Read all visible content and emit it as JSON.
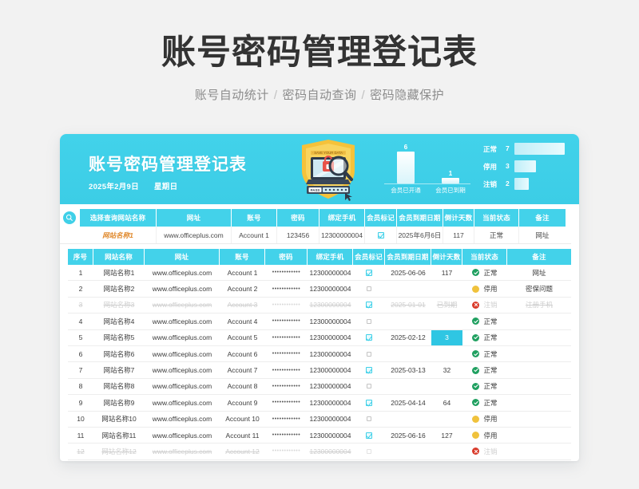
{
  "page": {
    "title": "账号密码管理登记表",
    "subtitle_parts": [
      "账号自动统计",
      "密码自动查询",
      "密码隐藏保护"
    ],
    "separator": "/",
    "background_color": "#f2f2f2",
    "accent_color": "#3fd0e8"
  },
  "banner": {
    "title": "账号密码管理登记表",
    "date": "2025年2月9日",
    "weekday": "星期日",
    "logo_name": "shield-lock-search-badge",
    "logo_text": "PASS"
  },
  "member_chart": {
    "type": "bar",
    "categories": [
      "会员已开通",
      "会员已到期"
    ],
    "values": [
      6,
      1
    ],
    "title": "",
    "xlabel": "",
    "ylabel": "",
    "ylim": [
      0,
      7
    ]
  },
  "status_chart": {
    "type": "bar",
    "orientation": "horizontal",
    "categories": [
      "正常",
      "停用",
      "注销"
    ],
    "values": [
      7,
      3,
      2
    ],
    "xlim": [
      0,
      7
    ]
  },
  "query": {
    "search_icon": "search-icon",
    "headers": [
      "选择查询网站名称",
      "网址",
      "账号",
      "密码",
      "绑定手机",
      "会员标记",
      "会员到期日期",
      "倒计天数",
      "当前状态",
      "备注"
    ],
    "row": {
      "site": "网站名称1",
      "url": "www.officeplus.com",
      "account": "Account 1",
      "password": "123456",
      "phone": "12300000004",
      "member": "checked",
      "expire": "2025年6月6日",
      "countdown": "117",
      "status": "正常",
      "note": "网址"
    }
  },
  "table": {
    "headers": [
      "序号",
      "网站名称",
      "网址",
      "账号",
      "密码",
      "绑定手机",
      "会员标记",
      "会员到期日期",
      "倒计天数",
      "当前状态",
      "备注"
    ],
    "password_mask": "••••••••••••",
    "rows": [
      {
        "no": "1",
        "site": "网站名称1",
        "url": "www.officeplus.com",
        "account": "Account 1",
        "phone": "12300000004",
        "member": "checked",
        "expire": "2025-06-06",
        "countdown": "117",
        "countdown_highlight": false,
        "status": "正常",
        "status_kind": "ok",
        "note": "网址",
        "dim": false
      },
      {
        "no": "2",
        "site": "网站名称2",
        "url": "www.officeplus.com",
        "account": "Account 2",
        "phone": "12300000004",
        "member": "unchecked",
        "expire": "",
        "countdown": "",
        "countdown_highlight": false,
        "status": "停用",
        "status_kind": "pause",
        "note": "密保问题",
        "dim": false
      },
      {
        "no": "3",
        "site": "网站名称3",
        "url": "www.officeplus.com",
        "account": "Account 3",
        "phone": "12300000004",
        "member": "checked",
        "expire": "2025-01-01",
        "countdown": "已到期",
        "countdown_highlight": false,
        "status": "注销",
        "status_kind": "off",
        "note": "注册手机",
        "dim": true
      },
      {
        "no": "4",
        "site": "网站名称4",
        "url": "www.officeplus.com",
        "account": "Account 4",
        "phone": "12300000004",
        "member": "unchecked",
        "expire": "",
        "countdown": "",
        "countdown_highlight": false,
        "status": "正常",
        "status_kind": "ok",
        "note": "",
        "dim": false
      },
      {
        "no": "5",
        "site": "网站名称5",
        "url": "www.officeplus.com",
        "account": "Account 5",
        "phone": "12300000004",
        "member": "checked",
        "expire": "2025-02-12",
        "countdown": "3",
        "countdown_highlight": true,
        "status": "正常",
        "status_kind": "ok",
        "note": "",
        "dim": false
      },
      {
        "no": "6",
        "site": "网站名称6",
        "url": "www.officeplus.com",
        "account": "Account 6",
        "phone": "12300000004",
        "member": "unchecked",
        "expire": "",
        "countdown": "",
        "countdown_highlight": false,
        "status": "正常",
        "status_kind": "ok",
        "note": "",
        "dim": false
      },
      {
        "no": "7",
        "site": "网站名称7",
        "url": "www.officeplus.com",
        "account": "Account 7",
        "phone": "12300000004",
        "member": "checked",
        "expire": "2025-03-13",
        "countdown": "32",
        "countdown_highlight": false,
        "status": "正常",
        "status_kind": "ok",
        "note": "",
        "dim": false
      },
      {
        "no": "8",
        "site": "网站名称8",
        "url": "www.officeplus.com",
        "account": "Account 8",
        "phone": "12300000004",
        "member": "unchecked",
        "expire": "",
        "countdown": "",
        "countdown_highlight": false,
        "status": "正常",
        "status_kind": "ok",
        "note": "",
        "dim": false
      },
      {
        "no": "9",
        "site": "网站名称9",
        "url": "www.officeplus.com",
        "account": "Account 9",
        "phone": "12300000004",
        "member": "checked",
        "expire": "2025-04-14",
        "countdown": "64",
        "countdown_highlight": false,
        "status": "正常",
        "status_kind": "ok",
        "note": "",
        "dim": false
      },
      {
        "no": "10",
        "site": "网站名称10",
        "url": "www.officeplus.com",
        "account": "Account 10",
        "phone": "12300000004",
        "member": "unchecked",
        "expire": "",
        "countdown": "",
        "countdown_highlight": false,
        "status": "停用",
        "status_kind": "pause",
        "note": "",
        "dim": false
      },
      {
        "no": "11",
        "site": "网站名称11",
        "url": "www.officeplus.com",
        "account": "Account 11",
        "phone": "12300000004",
        "member": "checked",
        "expire": "2025-06-16",
        "countdown": "127",
        "countdown_highlight": false,
        "status": "停用",
        "status_kind": "pause",
        "note": "",
        "dim": false
      },
      {
        "no": "12",
        "site": "网站名称12",
        "url": "www.officeplus.com",
        "account": "Account 12",
        "phone": "12300000004",
        "member": "unchecked",
        "expire": "",
        "countdown": "",
        "countdown_highlight": false,
        "status": "注销",
        "status_kind": "off",
        "note": "",
        "dim": true
      }
    ]
  }
}
